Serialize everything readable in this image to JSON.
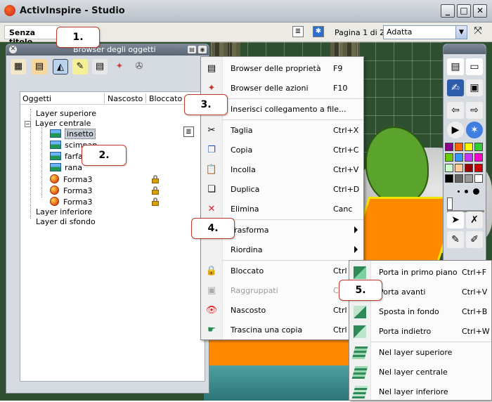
{
  "window": {
    "title": "ActivInspire - Studio"
  },
  "toolbar": {
    "doc_title": "Senza titolo",
    "page_info": "Pagina 1 di 2",
    "zoom_value": "Adatta"
  },
  "panel": {
    "title": "Browser degli oggetti",
    "columns": {
      "objects": "Oggetti",
      "hidden": "Nascosto",
      "locked": "Bloccato"
    },
    "layers": {
      "top": "Layer superiore",
      "middle": "Layer centrale",
      "bottom": "Layer inferiore",
      "background": "Layer di sfondo"
    },
    "items": [
      {
        "name": "insetto",
        "kind": "image",
        "locked": false
      },
      {
        "name": "scimpan",
        "kind": "image",
        "locked": false
      },
      {
        "name": "farfa",
        "kind": "image",
        "locked": false
      },
      {
        "name": "rana",
        "kind": "image",
        "locked": false
      },
      {
        "name": "Forma3",
        "kind": "shape",
        "locked": true
      },
      {
        "name": "Forma3",
        "kind": "shape",
        "locked": true
      },
      {
        "name": "Forma3",
        "kind": "shape",
        "locked": true
      }
    ]
  },
  "context_menu": {
    "items": [
      {
        "label": "Browser delle proprietà",
        "shortcut": "F9",
        "icon": "properties-icon"
      },
      {
        "label": "Browser delle azioni",
        "shortcut": "F10",
        "icon": "actions-icon"
      },
      {
        "label": "Inserisci collegamento a file...",
        "shortcut": "",
        "icon": "link-icon"
      },
      {
        "label": "Taglia",
        "shortcut": "Ctrl+X",
        "icon": "scissors-icon"
      },
      {
        "label": "Copia",
        "shortcut": "Ctrl+C",
        "icon": "copy-icon"
      },
      {
        "label": "Incolla",
        "shortcut": "Ctrl+V",
        "icon": "paste-icon"
      },
      {
        "label": "Duplica",
        "shortcut": "Ctrl+D",
        "icon": "duplicate-icon"
      },
      {
        "label": "Elimina",
        "shortcut": "Canc",
        "icon": "delete-icon"
      },
      {
        "label": "Trasforma",
        "shortcut": "",
        "icon": "transform-icon"
      },
      {
        "label": "Riordina",
        "shortcut": "",
        "icon": "reorder-icon"
      },
      {
        "label": "Bloccato",
        "shortcut": "Ctrl",
        "icon": "lock-icon"
      },
      {
        "label": "Raggruppati",
        "shortcut": "C",
        "icon": "group-icon"
      },
      {
        "label": "Nascosto",
        "shortcut": "Ctrl",
        "icon": "hidden-icon"
      },
      {
        "label": "Trascina una copia",
        "shortcut": "Ctrl",
        "icon": "drag-copy-icon"
      }
    ]
  },
  "submenu": {
    "items": [
      {
        "label": "Porta in primo piano",
        "shortcut": "Ctrl+F"
      },
      {
        "label": "Porta avanti",
        "shortcut": "Ctrl+V"
      },
      {
        "label": "Sposta in fondo",
        "shortcut": "Ctrl+B"
      },
      {
        "label": "Porta indietro",
        "shortcut": "Ctrl+W"
      },
      {
        "label": "Nel layer superiore",
        "shortcut": ""
      },
      {
        "label": "Nel layer centrale",
        "shortcut": ""
      },
      {
        "label": "Nel layer inferiore",
        "shortcut": ""
      }
    ]
  },
  "callouts": [
    "1.",
    "2.",
    "3.",
    "4.",
    "5."
  ],
  "colors": {
    "accent_red": "#c0392b",
    "palette": [
      "#8b008b",
      "#ff6600",
      "#ffff00",
      "#33cc33",
      "#66cc00",
      "#3399ff",
      "#cc33ff",
      "#ff00cc",
      "#ccffcc",
      "#ffcc99",
      "#990000",
      "#cc0000",
      "#000000",
      "#666666",
      "#999999",
      "#ffffff"
    ]
  }
}
